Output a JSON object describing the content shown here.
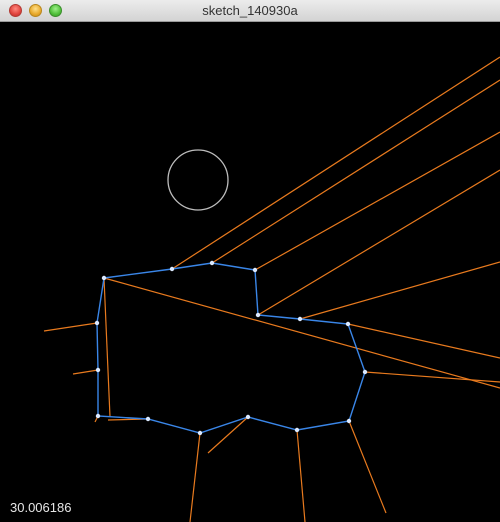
{
  "window": {
    "title": "sketch_140930a"
  },
  "canvas": {
    "background": "#000000",
    "polygon_color": "#3a86e8",
    "ray_color": "#e87a1e",
    "circle_color": "#bdbdbd",
    "readout": "30.006186"
  },
  "icons": {
    "close": "close-button-icon",
    "minimize": "minimize-button-icon",
    "zoom": "zoom-button-icon"
  }
}
